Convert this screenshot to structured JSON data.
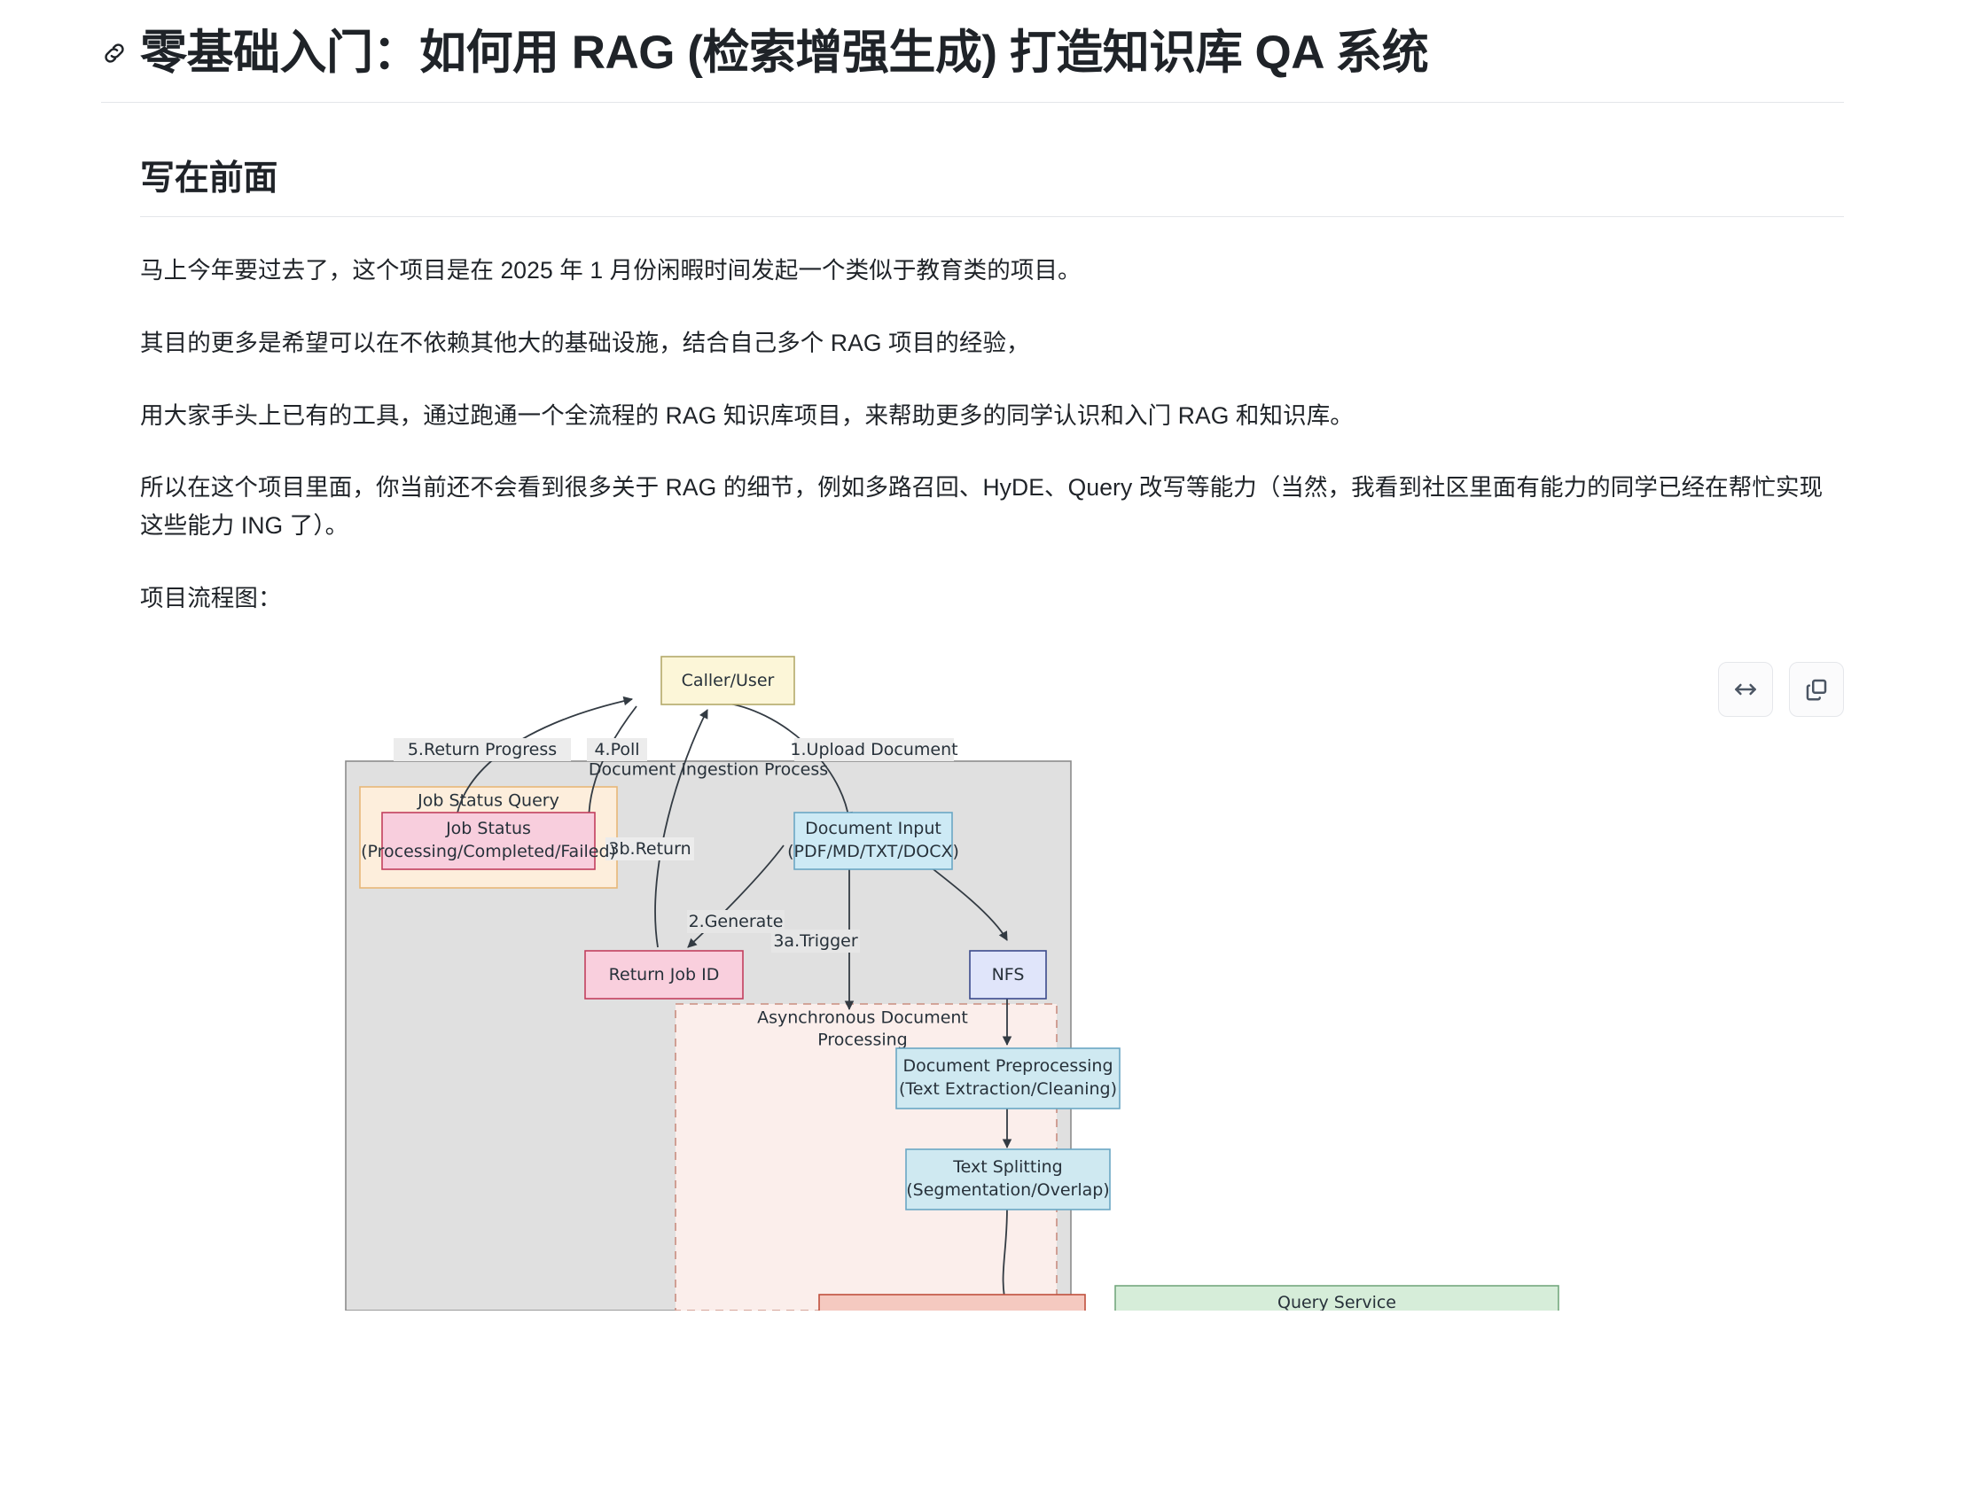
{
  "article": {
    "title": "零基础入门：如何用 RAG (检索增强生成) 打造知识库 QA 系统",
    "anchor_icon": "link-icon",
    "section_heading": "写在前面",
    "paragraphs": [
      "马上今年要过去了，这个项目是在 2025 年 1 月份闲暇时间发起一个类似于教育类的项目。",
      "其目的更多是希望可以在不依赖其他大的基础设施，结合自己多个 RAG 项目的经验，",
      "用大家手头上已有的工具，通过跑通一个全流程的 RAG 知识库项目，来帮助更多的同学认识和入门 RAG 和知识库。",
      "所以在这个项目里面，你当前还不会看到很多关于 RAG 的细节，例如多路召回、HyDE、Query 改写等能力（当然，我看到社区里面有能力的同学已经在帮忙实现这些能力 ING 了）。",
      "项目流程图："
    ]
  },
  "diagram_toolbar": {
    "buttons": [
      {
        "name": "expand-width-button",
        "icon": "horizontal-arrows-icon",
        "label": ""
      },
      {
        "name": "copy-button",
        "icon": "copy-icon",
        "label": ""
      }
    ]
  },
  "diagram": {
    "type": "flowchart",
    "clusters": [
      {
        "id": "ingestion",
        "label": "Document Ingestion Process",
        "fill": "#e0e0e0",
        "stroke": "#8c8c8c",
        "style": "solid"
      },
      {
        "id": "jobquery",
        "label": "Job Status Query",
        "fill": "#fdeedc",
        "stroke": "#e8b778",
        "style": "solid"
      },
      {
        "id": "async",
        "label": "Asynchronous Document Processing",
        "fill": "#fbeeeb",
        "stroke": "#c98d80",
        "style": "dashed"
      }
    ],
    "nodes": [
      {
        "id": "caller",
        "label": "Caller/User",
        "fill": "#fcf6d8",
        "stroke": "#b4aa6a"
      },
      {
        "id": "jobstatus",
        "label": "Job Status",
        "sublabel": "(Processing/Completed/Failed)",
        "fill": "#f8cedd",
        "stroke": "#c23f5e"
      },
      {
        "id": "docinput",
        "label": "Document Input",
        "sublabel": "(PDF/MD/TXT/DOCX)",
        "fill": "#cdeaf5",
        "stroke": "#6aa7c4"
      },
      {
        "id": "returnjobid",
        "label": "Return Job ID",
        "fill": "#f9cfdd",
        "stroke": "#c23f5e"
      },
      {
        "id": "nfs",
        "label": "NFS",
        "fill": "#e0e5fa",
        "stroke": "#3b4a8c"
      },
      {
        "id": "preprocess",
        "label": "Document Preprocessing",
        "sublabel": "(Text Extraction/Cleaning)",
        "fill": "#cfe9f1",
        "stroke": "#6aa7c4"
      },
      {
        "id": "splitting",
        "label": "Text Splitting",
        "sublabel": "(Segmentation/Overlap)",
        "fill": "#cfe9f1",
        "stroke": "#6aa7c4"
      },
      {
        "id": "cutoff",
        "label": "",
        "fill": "#f5c9c0",
        "stroke": "#c0503d"
      },
      {
        "id": "queryservice",
        "label": "Query Service",
        "fill": "#d6edd9",
        "stroke": "#74a87e"
      }
    ],
    "edges": [
      {
        "from": "caller",
        "to": "docinput",
        "label": "1.Upload Document"
      },
      {
        "from": "docinput",
        "to": "returnjobid",
        "label": "2.Generate"
      },
      {
        "from": "docinput",
        "to": "async",
        "label": "3a.Trigger"
      },
      {
        "from": "returnjobid",
        "to": "caller",
        "label": "3b.Return"
      },
      {
        "from": "caller",
        "to": "jobstatus",
        "label": "4.Poll"
      },
      {
        "from": "jobstatus",
        "to": "caller",
        "label": "5.Return Progress"
      },
      {
        "from": "docinput",
        "to": "nfs",
        "label": ""
      },
      {
        "from": "nfs",
        "to": "preprocess",
        "label": ""
      },
      {
        "from": "preprocess",
        "to": "splitting",
        "label": ""
      },
      {
        "from": "splitting",
        "to": "cutoff",
        "label": ""
      }
    ]
  }
}
